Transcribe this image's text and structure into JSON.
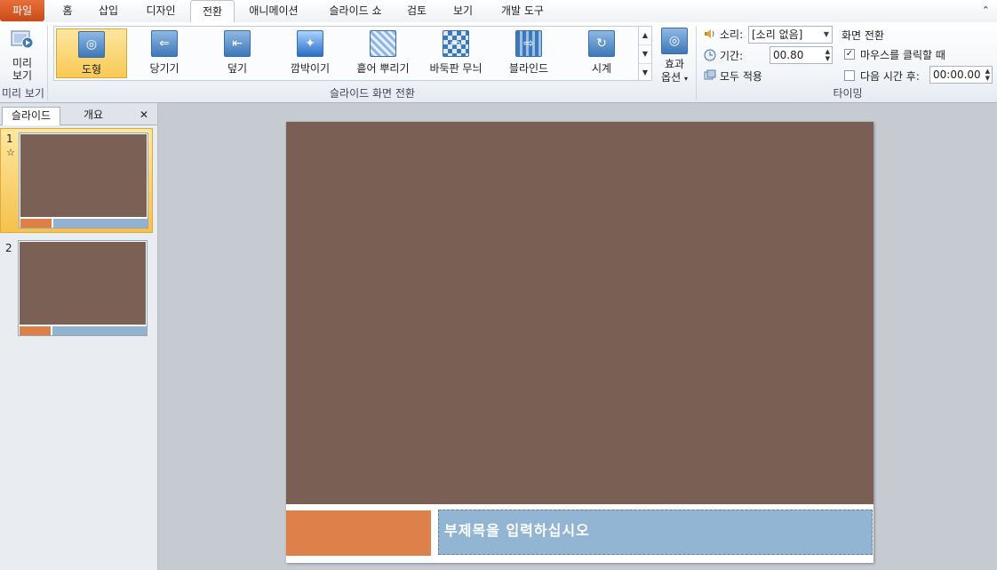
{
  "tabs": {
    "file": "파일",
    "items": [
      "홈",
      "삽입",
      "디자인",
      "전환",
      "애니메이션",
      "슬라이드 쇼",
      "검토",
      "보기",
      "개발 도구"
    ],
    "active_index": 3
  },
  "ribbon": {
    "preview": {
      "label_line1": "미리",
      "label_line2": "보기",
      "group_label": "미리 보기"
    },
    "transitions": {
      "group_label": "슬라이드 화면 전환",
      "items": [
        "도형",
        "당기기",
        "덮기",
        "깜박이기",
        "흩어 뿌리기",
        "바둑판 무늬",
        "블라인드",
        "시계"
      ],
      "selected_index": 0,
      "icons": [
        "shape-transition-icon",
        "pull-transition-icon",
        "cover-transition-icon",
        "flash-transition-icon",
        "dissolve-transition-icon",
        "checkerboard-transition-icon",
        "blinds-transition-icon",
        "clock-transition-icon"
      ]
    },
    "effect_options": {
      "line1": "효과",
      "line2": "옵션"
    },
    "timing": {
      "group_label": "타이밍",
      "sound_label": "소리:",
      "sound_value": "[소리 없음]",
      "duration_label": "기간:",
      "duration_value": "00.80",
      "apply_all": "모두 적용",
      "advance_title": "화면 전환",
      "on_click_label": "마우스를 클릭할 때",
      "on_click_checked": true,
      "after_label": "다음 시간 후:",
      "after_value": "00:00.00",
      "after_checked": false
    }
  },
  "left_panel": {
    "tab_slides": "슬라이드",
    "tab_outline": "개요",
    "close": "✕",
    "slides": [
      {
        "number": "1",
        "has_transition": true,
        "star": "☆"
      },
      {
        "number": "2",
        "has_transition": false
      }
    ]
  },
  "slide": {
    "subtitle_placeholder": "부제목을 입력하십시오"
  },
  "colors": {
    "slide_background": "#7a5f54",
    "accent_orange": "#de804a",
    "accent_blue": "#92b5d3",
    "file_tab": "#d65a24",
    "selected_item": "#f8c954"
  }
}
